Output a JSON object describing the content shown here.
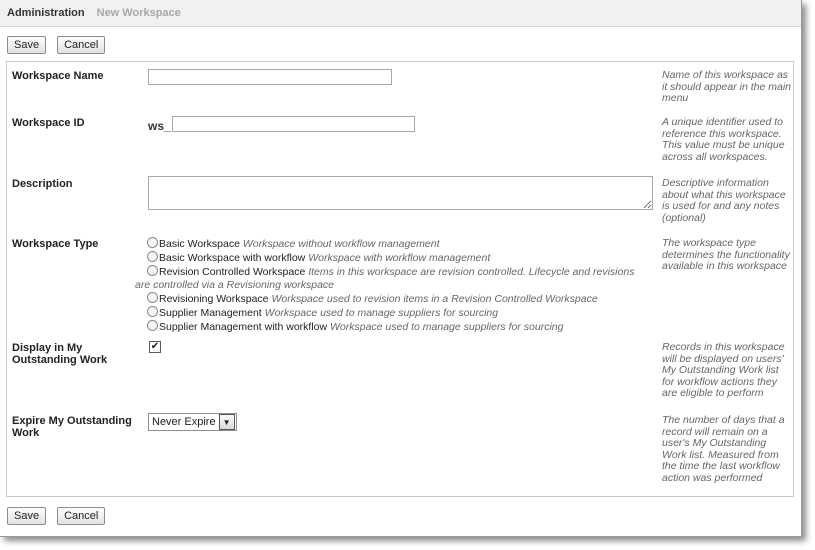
{
  "breadcrumb": {
    "main": "Administration",
    "sub": "New Workspace"
  },
  "toolbar": {
    "save_label": "Save",
    "cancel_label": "Cancel"
  },
  "fields": {
    "name": {
      "label": "Workspace Name",
      "value": "",
      "help": "Name of this workspace as it should appear in the main menu"
    },
    "id": {
      "label": "Workspace ID",
      "prefix": "ws_",
      "value": "",
      "help": "A unique identifier used to reference this workspace. This value must be unique across all workspaces."
    },
    "description": {
      "label": "Description",
      "value": "",
      "help": "Descriptive information about what this workspace is used for and any notes (optional)"
    },
    "type": {
      "label": "Workspace Type",
      "help": "The workspace type determines the functionality available in this workspace",
      "options": [
        {
          "name": "Basic Workspace",
          "desc": "Workspace without workflow management"
        },
        {
          "name": "Basic Workspace with workflow",
          "desc": "Workspace with workflow management"
        },
        {
          "name": "Revision Controlled Workspace",
          "desc": "Items in this workspace are revision controlled. Lifecycle and revisions are controlled via a Revisioning workspace"
        },
        {
          "name": "Revisioning Workspace",
          "desc": "Workspace used to revision items in a Revision Controlled Workspace"
        },
        {
          "name": "Supplier Management",
          "desc": "Workspace used to manage suppliers for sourcing"
        },
        {
          "name": "Supplier Management with workflow",
          "desc": "Workspace used to manage suppliers for sourcing"
        }
      ]
    },
    "outstanding": {
      "label": "Display in My Outstanding Work",
      "checked": true,
      "check_glyph": "✔",
      "help": "Records in this workspace will be displayed on users' My Outstanding Work list for workflow actions they are eligible to perform"
    },
    "expire": {
      "label": "Expire My Outstanding Work",
      "value": "Never Expire",
      "help": "The number of days that a record will remain on a user's My Outstanding Work list. Measured from the time the last workflow action was performed"
    }
  }
}
